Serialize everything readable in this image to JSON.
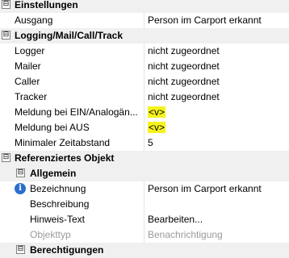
{
  "sections": {
    "einstellungen": {
      "title": "Einstellungen"
    },
    "logging": {
      "title": "Logging/Mail/Call/Track"
    },
    "referenz": {
      "title": "Referenziertes Objekt"
    },
    "allgemein": {
      "title": "Allgemein"
    },
    "berechtigungen": {
      "title": "Berechtigungen"
    }
  },
  "rows": {
    "ausgang": {
      "label": "Ausgang",
      "value": "Person im Carport erkannt"
    },
    "logger": {
      "label": "Logger",
      "value": "nicht zugeordnet"
    },
    "mailer": {
      "label": "Mailer",
      "value": "nicht zugeordnet"
    },
    "caller": {
      "label": "Caller",
      "value": "nicht zugeordnet"
    },
    "tracker": {
      "label": "Tracker",
      "value": "nicht zugeordnet"
    },
    "ein": {
      "label": "Meldung bei EIN/Analogän...",
      "value": "<v>"
    },
    "aus": {
      "label": "Meldung bei AUS",
      "value": "<v>"
    },
    "zeitabstand": {
      "label": "Minimaler Zeitabstand",
      "value": "5"
    },
    "bezeichnung": {
      "label": "Bezeichnung",
      "value": "Person im Carport erkannt"
    },
    "beschreibung": {
      "label": "Beschreibung",
      "value": ""
    },
    "hinweis": {
      "label": "Hinweis-Text",
      "value": "Bearbeiten..."
    },
    "objekttyp": {
      "label": "Objekttyp",
      "value": "Benachrichtigung"
    }
  },
  "icons": {
    "collapse": "⊟",
    "info": "i"
  },
  "colors": {
    "highlight": "#f6f31c",
    "info_blue": "#2c6fcc",
    "category_bg": "#f0f0f0"
  }
}
